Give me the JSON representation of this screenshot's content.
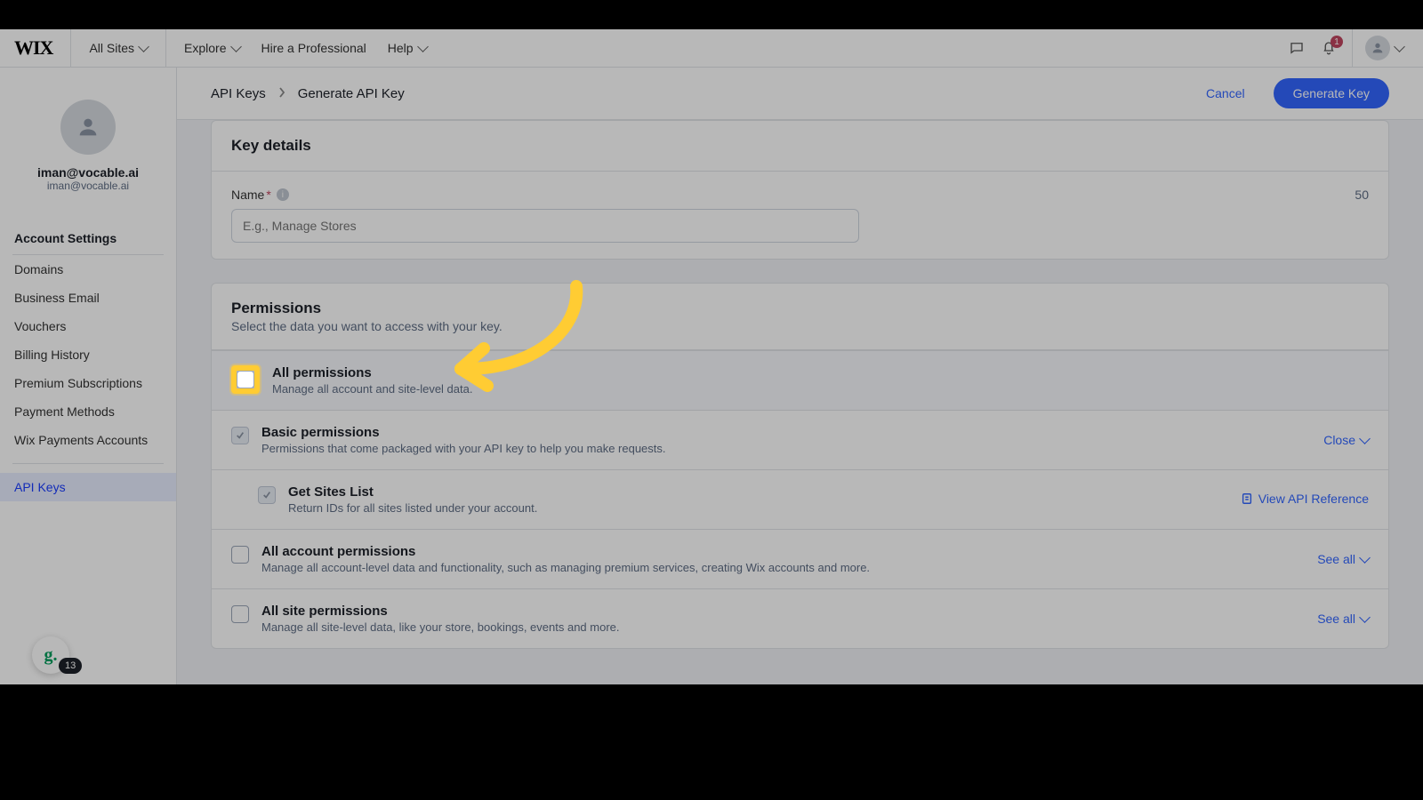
{
  "topnav": {
    "logo": "WIX",
    "all_sites": "All Sites",
    "explore": "Explore",
    "hire": "Hire a Professional",
    "help": "Help",
    "notif_count": "1"
  },
  "sidebar": {
    "user_name": "iman@vocable.ai",
    "user_email": "iman@vocable.ai",
    "heading": "Account Settings",
    "items": [
      {
        "label": "Domains"
      },
      {
        "label": "Business Email"
      },
      {
        "label": "Vouchers"
      },
      {
        "label": "Billing History"
      },
      {
        "label": "Premium Subscriptions"
      },
      {
        "label": "Payment Methods"
      },
      {
        "label": "Wix Payments Accounts"
      }
    ],
    "active": "API Keys"
  },
  "breadcrumb": {
    "parent": "API Keys",
    "current": "Generate API Key"
  },
  "actions": {
    "cancel": "Cancel",
    "generate": "Generate Key"
  },
  "key_details": {
    "title": "Key details",
    "name_label": "Name",
    "name_placeholder": "E.g., Manage Stores",
    "char_limit": "50"
  },
  "permissions": {
    "title": "Permissions",
    "subtitle": "Select the data you want to access with your key.",
    "all": {
      "label": "All permissions",
      "desc": "Manage all account and site-level data."
    },
    "basic": {
      "label": "Basic permissions",
      "desc": "Permissions that come packaged with your API key to help you make requests.",
      "toggle": "Close"
    },
    "get_sites": {
      "label": "Get Sites List",
      "desc": "Return IDs for all sites listed under your account.",
      "link": "View API Reference"
    },
    "account": {
      "label": "All account permissions",
      "desc": "Manage all account-level data and functionality, such as managing premium services, creating Wix accounts and more.",
      "toggle": "See all"
    },
    "site": {
      "label": "All site permissions",
      "desc": "Manage all site-level data, like your store, bookings, events and more.",
      "toggle": "See all"
    }
  },
  "float_badge": {
    "glyph": "g.",
    "count": "13"
  }
}
